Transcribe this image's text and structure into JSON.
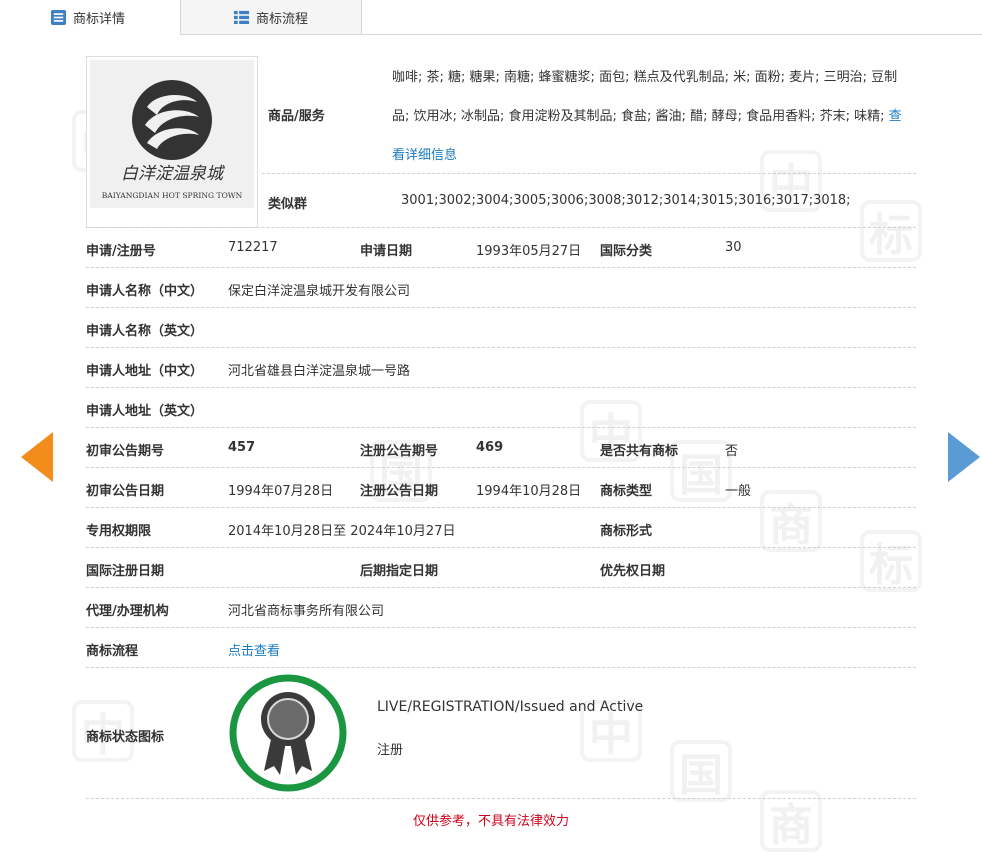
{
  "tabs": [
    {
      "label": "商标详情",
      "icon": "list-icon",
      "active": true
    },
    {
      "label": "商标流程",
      "icon": "grid-list-icon",
      "active": false
    }
  ],
  "logo": {
    "name_cn": "白洋淀温泉城",
    "name_en": "BAIYANGDIAN HOT SPRING TOWN"
  },
  "watermark_text": [
    "中",
    "国",
    "商",
    "标"
  ],
  "goods": {
    "label": "商品/服务",
    "text": "咖啡; 茶; 糖; 糖果; 南糖; 蜂蜜糖浆; 面包; 糕点及代乳制品; 米; 面粉; 麦片; 三明治; 豆制品; 饮用冰; 冰制品; 食用淀粉及其制品; 食盐; 酱油; 醋; 酵母; 食品用香料; 芥末; 味精; ",
    "more_link": "查看详细信息"
  },
  "similar": {
    "label": "类似群",
    "value": "3001;3002;3004;3005;3006;3008;3012;3014;3015;3016;3017;3018;"
  },
  "fields": {
    "reg_no_label": "申请/注册号",
    "reg_no": "712217",
    "app_date_label": "申请日期",
    "app_date": "1993年05月27日",
    "intl_class_label": "国际分类",
    "intl_class": "30",
    "applicant_cn_label": "申请人名称（中文）",
    "applicant_cn": "保定白洋淀温泉城开发有限公司",
    "applicant_en_label": "申请人名称（英文）",
    "applicant_en": "",
    "address_cn_label": "申请人地址（中文）",
    "address_cn": "河北省雄县白洋淀温泉城一号路",
    "address_en_label": "申请人地址（英文）",
    "address_en": "",
    "prelim_no_label": "初审公告期号",
    "prelim_no": "457",
    "reg_pub_no_label": "注册公告期号",
    "reg_pub_no": "469",
    "shared_label": "是否共有商标",
    "shared": "否",
    "prelim_date_label": "初审公告日期",
    "prelim_date": "1994年07月28日",
    "reg_pub_date_label": "注册公告日期",
    "reg_pub_date": "1994年10月28日",
    "tm_type_label": "商标类型",
    "tm_type": "一般",
    "exclusive_label": "专用权期限",
    "exclusive": "2014年10月28日至 2024年10月27日",
    "tm_form_label": "商标形式",
    "tm_form": "",
    "intl_reg_date_label": "国际注册日期",
    "intl_reg_date": "",
    "later_date_label": "后期指定日期",
    "later_date": "",
    "priority_date_label": "优先权日期",
    "priority_date": "",
    "agent_label": "代理/办理机构",
    "agent": "河北省商标事务所有限公司",
    "flow_label": "商标流程",
    "flow_link": "点击查看",
    "status_label": "商标状态图标",
    "status_en": "LIVE/REGISTRATION/Issued and Active",
    "status_cn": "注册"
  },
  "nav": {
    "prev_icon": "arrow-left-icon",
    "next_icon": "arrow-right-icon"
  },
  "footer": "仅供参考，不具有法律效力",
  "colors": {
    "link": "#1a7bc4",
    "prev_arrow": "#f28c1b",
    "next_arrow": "#5b9bd5",
    "status_ring": "#1a9641",
    "footer": "#d0021b"
  }
}
